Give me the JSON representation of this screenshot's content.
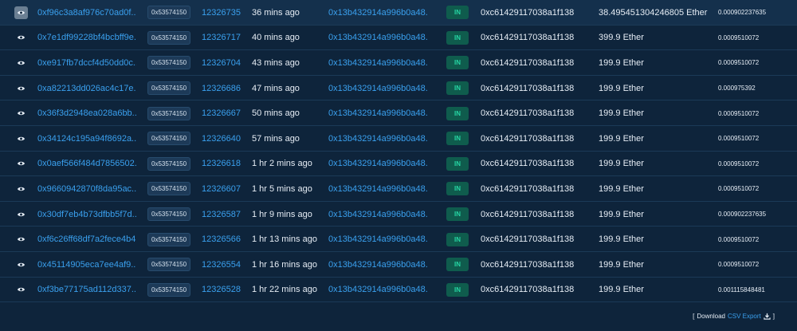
{
  "transactions": [
    {
      "hash": "0xf96c3a8af976c70ad0f...",
      "method": "0x53574150",
      "block": "12326735",
      "age": "36 mins ago",
      "from": "0x13b432914a996b0a48...",
      "direction": "IN",
      "to": "0xc61429117038a1f138...",
      "value": "38.495451304246805 Ether",
      "fee": "0.000902237635"
    },
    {
      "hash": "0x7e1df99228bf4bcbff9e...",
      "method": "0x53574150",
      "block": "12326717",
      "age": "40 mins ago",
      "from": "0x13b432914a996b0a48...",
      "direction": "IN",
      "to": "0xc61429117038a1f138...",
      "value": "399.9 Ether",
      "fee": "0.0009510072"
    },
    {
      "hash": "0xe917fb7dccf4d50dd0c...",
      "method": "0x53574150",
      "block": "12326704",
      "age": "43 mins ago",
      "from": "0x13b432914a996b0a48...",
      "direction": "IN",
      "to": "0xc61429117038a1f138...",
      "value": "199.9 Ether",
      "fee": "0.0009510072"
    },
    {
      "hash": "0xa82213dd026ac4c17e...",
      "method": "0x53574150",
      "block": "12326686",
      "age": "47 mins ago",
      "from": "0x13b432914a996b0a48...",
      "direction": "IN",
      "to": "0xc61429117038a1f138...",
      "value": "199.9 Ether",
      "fee": "0.000975392"
    },
    {
      "hash": "0x36f3d2948ea028a6bb...",
      "method": "0x53574150",
      "block": "12326667",
      "age": "50 mins ago",
      "from": "0x13b432914a996b0a48...",
      "direction": "IN",
      "to": "0xc61429117038a1f138...",
      "value": "199.9 Ether",
      "fee": "0.0009510072"
    },
    {
      "hash": "0x34124c195a94f8692a...",
      "method": "0x53574150",
      "block": "12326640",
      "age": "57 mins ago",
      "from": "0x13b432914a996b0a48...",
      "direction": "IN",
      "to": "0xc61429117038a1f138...",
      "value": "199.9 Ether",
      "fee": "0.0009510072"
    },
    {
      "hash": "0x0aef566f484d7856502...",
      "method": "0x53574150",
      "block": "12326618",
      "age": "1 hr 2 mins ago",
      "from": "0x13b432914a996b0a48...",
      "direction": "IN",
      "to": "0xc61429117038a1f138...",
      "value": "199.9 Ether",
      "fee": "0.0009510072"
    },
    {
      "hash": "0x9660942870f8da95ac...",
      "method": "0x53574150",
      "block": "12326607",
      "age": "1 hr 5 mins ago",
      "from": "0x13b432914a996b0a48...",
      "direction": "IN",
      "to": "0xc61429117038a1f138...",
      "value": "199.9 Ether",
      "fee": "0.0009510072"
    },
    {
      "hash": "0x30df7eb4b73dfbb5f7d...",
      "method": "0x53574150",
      "block": "12326587",
      "age": "1 hr 9 mins ago",
      "from": "0x13b432914a996b0a48...",
      "direction": "IN",
      "to": "0xc61429117038a1f138...",
      "value": "199.9 Ether",
      "fee": "0.000902237635"
    },
    {
      "hash": "0xf6c26ff68df7a2fece4b4...",
      "method": "0x53574150",
      "block": "12326566",
      "age": "1 hr 13 mins ago",
      "from": "0x13b432914a996b0a48...",
      "direction": "IN",
      "to": "0xc61429117038a1f138...",
      "value": "199.9 Ether",
      "fee": "0.0009510072"
    },
    {
      "hash": "0x45114905eca7ee4af9...",
      "method": "0x53574150",
      "block": "12326554",
      "age": "1 hr 16 mins ago",
      "from": "0x13b432914a996b0a48...",
      "direction": "IN",
      "to": "0xc61429117038a1f138...",
      "value": "199.9 Ether",
      "fee": "0.0009510072"
    },
    {
      "hash": "0xf3be77175ad112d337...",
      "method": "0x53574150",
      "block": "12326528",
      "age": "1 hr 22 mins ago",
      "from": "0x13b432914a996b0a48...",
      "direction": "IN",
      "to": "0xc61429117038a1f138...",
      "value": "199.9 Ether",
      "fee": "0.001115848481"
    }
  ],
  "footer": {
    "open_bracket": "[",
    "download_label": "Download",
    "csv_label": "CSV Export",
    "close_bracket": "]"
  },
  "icons": {
    "row_action": "eye-icon",
    "download": "download-icon"
  },
  "colors": {
    "background": "#0e243b",
    "link": "#3aa0ee",
    "in_badge_bg": "#0f5c4d",
    "in_badge_text": "#26d6a4"
  }
}
